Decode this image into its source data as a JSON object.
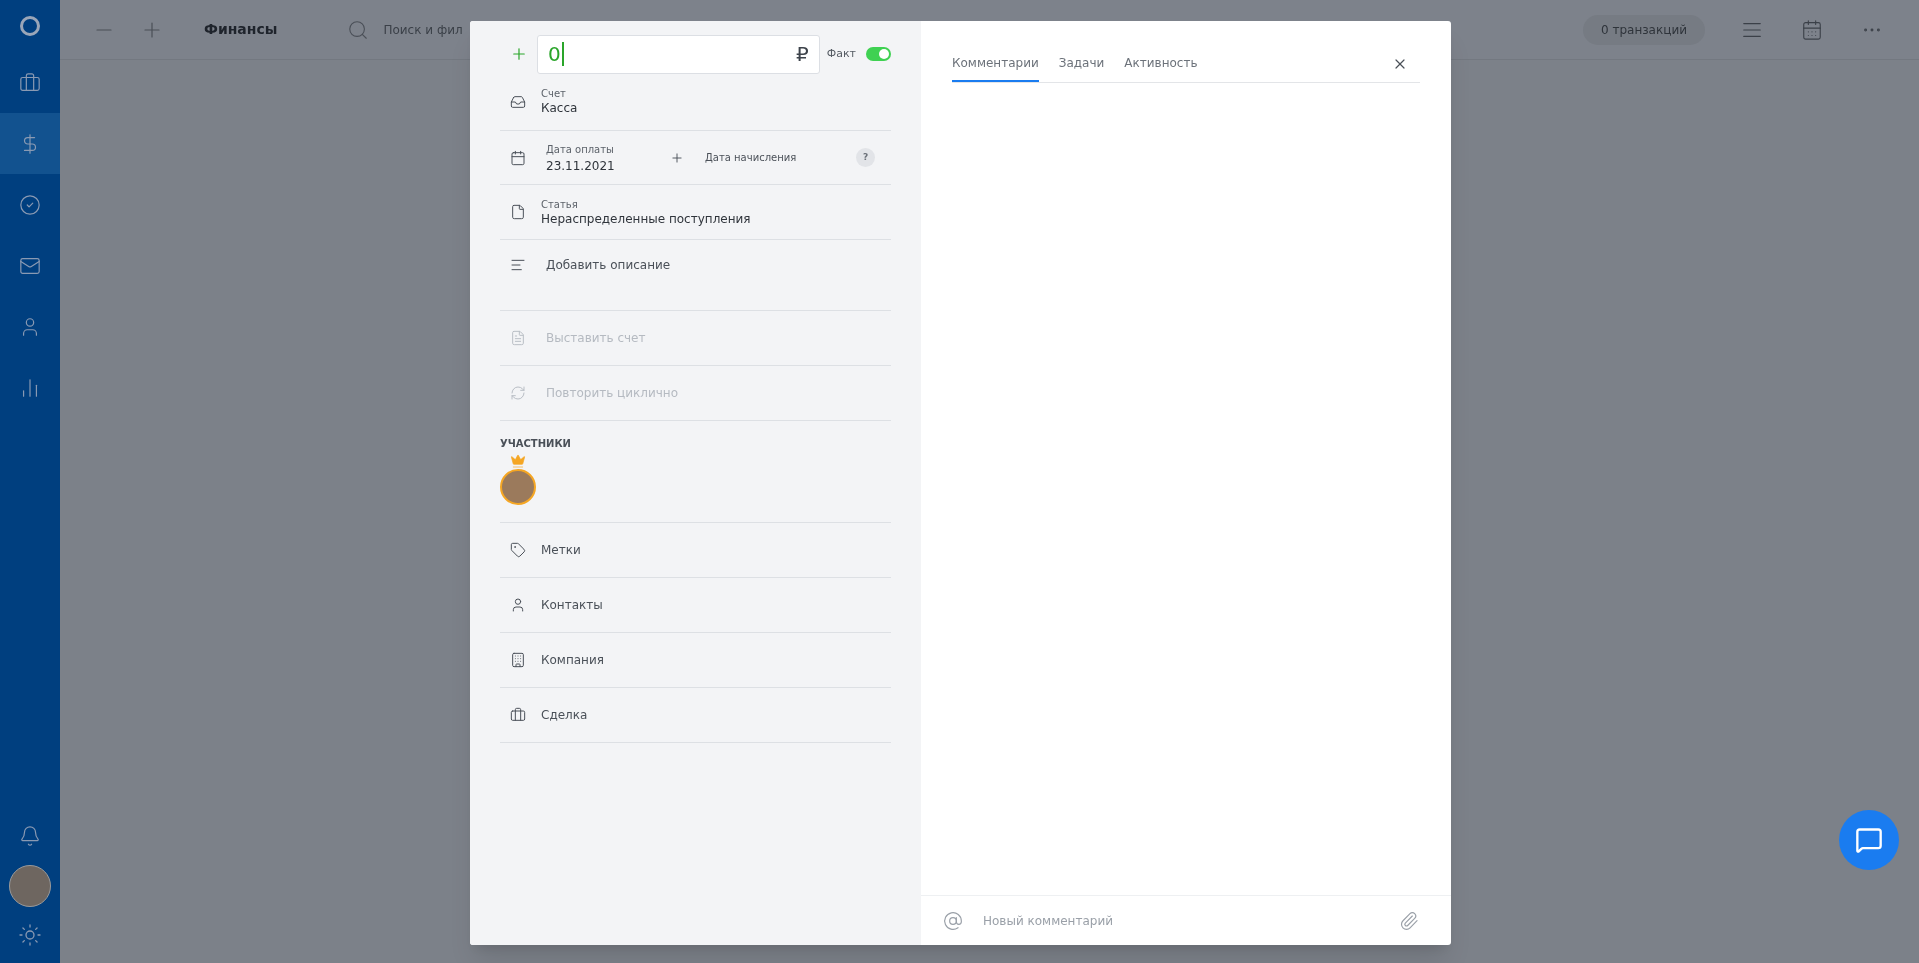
{
  "sidebar": {
    "nav": [
      {
        "selected": false
      },
      {
        "selected": true
      },
      {
        "selected": false
      },
      {
        "selected": false
      },
      {
        "selected": false
      },
      {
        "selected": false
      }
    ]
  },
  "topbar": {
    "title": "Финансы",
    "search": {
      "placeholder": "Поиск и фил"
    },
    "count": "0 транзакций"
  },
  "form": {
    "amount": {
      "value": "0",
      "currency": "₽"
    },
    "fact": {
      "label": "Факт",
      "on": true
    },
    "rows": [
      {
        "kind": "field",
        "label": "Счет",
        "value": "Касса"
      },
      {
        "kind": "dates",
        "label": "Дата оплаты",
        "value": "23.11.2021",
        "extra_label": "Дата начисления",
        "help": "?"
      },
      {
        "kind": "field",
        "label": "Статья",
        "value": "Нераспределенные поступления"
      },
      {
        "kind": "text",
        "label": "Добавить описание",
        "disabled": false
      },
      {
        "kind": "action",
        "label": "Выставить счет",
        "disabled": true
      },
      {
        "kind": "action",
        "label": "Повторить циклично",
        "disabled": true
      }
    ],
    "participants": {
      "title": "УЧАСТНИКИ",
      "members": [
        {
          "owner": true
        }
      ]
    },
    "links": [
      {
        "label": "Метки"
      },
      {
        "label": "Контакты"
      },
      {
        "label": "Компания"
      },
      {
        "label": "Сделка"
      }
    ]
  },
  "panel": {
    "tabs": [
      {
        "label": "Комментарии",
        "selected": true
      },
      {
        "label": "Задачи",
        "selected": false
      },
      {
        "label": "Активность",
        "selected": false
      }
    ],
    "comment": {
      "placeholder": "Новый комментарий"
    }
  }
}
